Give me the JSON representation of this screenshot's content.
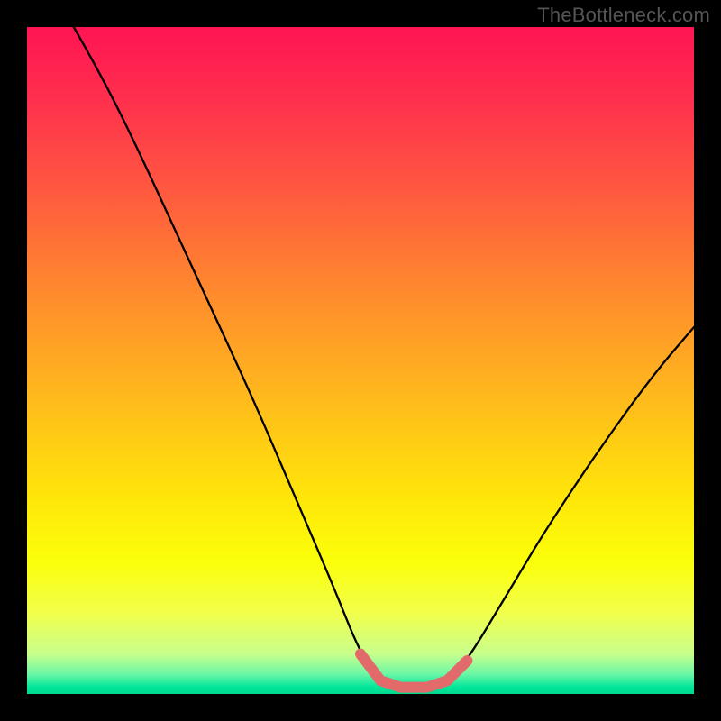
{
  "watermark": "TheBottleneck.com",
  "chart_data": {
    "type": "line",
    "title": "",
    "xlabel": "",
    "ylabel": "",
    "xlim": [
      0,
      100
    ],
    "ylim": [
      0,
      100
    ],
    "gradient_stops": [
      {
        "offset": 0,
        "color": "#ff1452"
      },
      {
        "offset": 10,
        "color": "#ff2d4e"
      },
      {
        "offset": 25,
        "color": "#ff5a3f"
      },
      {
        "offset": 40,
        "color": "#ff8b2d"
      },
      {
        "offset": 55,
        "color": "#ffb81d"
      },
      {
        "offset": 70,
        "color": "#ffe40a"
      },
      {
        "offset": 80,
        "color": "#fbff09"
      },
      {
        "offset": 88,
        "color": "#f1ff4d"
      },
      {
        "offset": 94,
        "color": "#c8ff8c"
      },
      {
        "offset": 97,
        "color": "#6cf7a6"
      },
      {
        "offset": 99,
        "color": "#00e69a"
      },
      {
        "offset": 100,
        "color": "#00d88e"
      }
    ],
    "series": [
      {
        "name": "bottleneck-curve",
        "color": "#000000",
        "points": [
          {
            "x": 7,
            "y": 100
          },
          {
            "x": 11,
            "y": 93
          },
          {
            "x": 16,
            "y": 83
          },
          {
            "x": 22,
            "y": 70
          },
          {
            "x": 28,
            "y": 57
          },
          {
            "x": 34,
            "y": 44
          },
          {
            "x": 40,
            "y": 30
          },
          {
            "x": 46,
            "y": 16
          },
          {
            "x": 50,
            "y": 6
          },
          {
            "x": 53,
            "y": 2
          },
          {
            "x": 56,
            "y": 1
          },
          {
            "x": 60,
            "y": 1
          },
          {
            "x": 63,
            "y": 2
          },
          {
            "x": 66,
            "y": 5
          },
          {
            "x": 72,
            "y": 15
          },
          {
            "x": 78,
            "y": 25
          },
          {
            "x": 86,
            "y": 37
          },
          {
            "x": 94,
            "y": 48
          },
          {
            "x": 100,
            "y": 55
          }
        ]
      }
    ],
    "marker": {
      "name": "optimal-zone",
      "color": "#e26a6a",
      "points": [
        {
          "x": 50,
          "y": 6
        },
        {
          "x": 53,
          "y": 2
        },
        {
          "x": 56,
          "y": 1
        },
        {
          "x": 60,
          "y": 1
        },
        {
          "x": 63,
          "y": 2
        },
        {
          "x": 66,
          "y": 5
        }
      ]
    }
  }
}
